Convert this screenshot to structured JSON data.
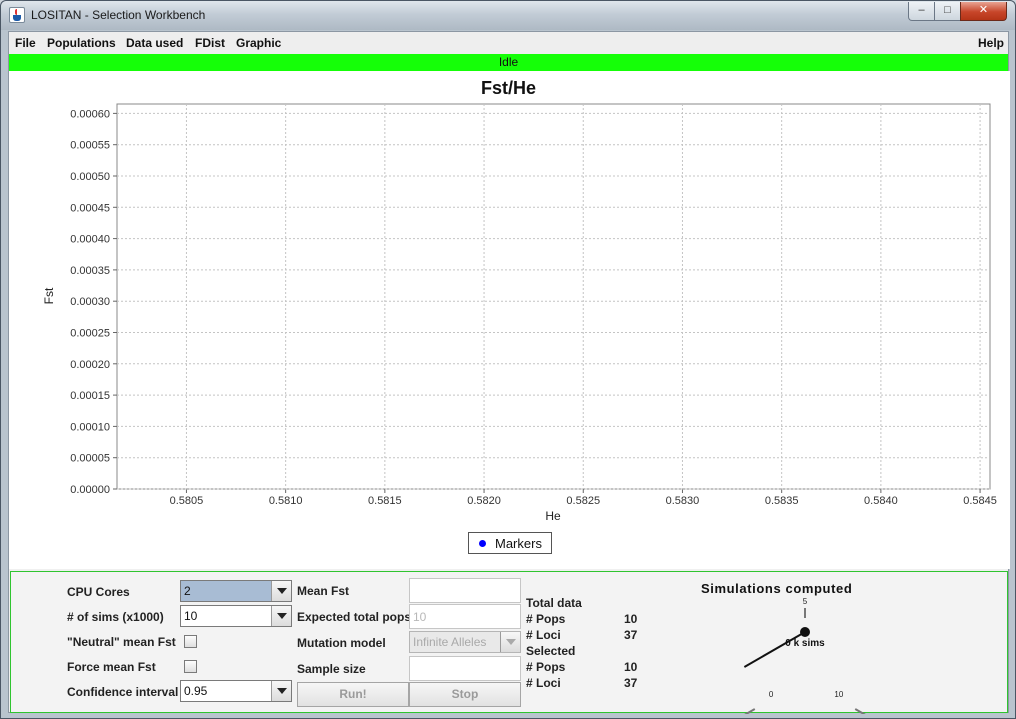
{
  "window": {
    "title": "LOSITAN - Selection Workbench",
    "minimize": "–",
    "maximize": "□",
    "close": "✕"
  },
  "menu": {
    "file": "File",
    "populations": "Populations",
    "data_used": "Data used",
    "fdist": "FDist",
    "graphic": "Graphic",
    "help": "Help"
  },
  "status": "Idle",
  "chart_data": {
    "type": "scatter",
    "title": "Fst/He",
    "xlabel": "He",
    "ylabel": "Fst",
    "xlim": [
      0.58015,
      0.58455
    ],
    "ylim": [
      0.0,
      0.000615
    ],
    "x_ticks": [
      "0.5805",
      "0.5810",
      "0.5815",
      "0.5820",
      "0.5825",
      "0.5830",
      "0.5835",
      "0.5840",
      "0.5845"
    ],
    "x_tick_values": [
      0.5805,
      0.581,
      0.5815,
      0.582,
      0.5825,
      0.583,
      0.5835,
      0.584,
      0.5845
    ],
    "y_ticks": [
      "0.00000",
      "0.00005",
      "0.00010",
      "0.00015",
      "0.00020",
      "0.00025",
      "0.00030",
      "0.00035",
      "0.00040",
      "0.00045",
      "0.00050",
      "0.00055",
      "0.00060"
    ],
    "y_tick_values": [
      0.0,
      5e-05,
      0.0001,
      0.00015,
      0.0002,
      0.00025,
      0.0003,
      0.00035,
      0.0004,
      0.00045,
      0.0005,
      0.00055,
      0.0006
    ],
    "grid": true,
    "legend": "bottom-center",
    "series": [
      {
        "name": "Markers",
        "color": "#0000ff",
        "x": [],
        "y": []
      }
    ]
  },
  "controls": {
    "cpu_cores_label": "CPU Cores",
    "cpu_cores_value": "2",
    "sims_label": "# of sims (x1000)",
    "sims_value": "10",
    "neutral_label": "\"Neutral\" mean Fst",
    "force_label": "Force mean Fst",
    "confidence_label": "Confidence interval",
    "confidence_value": "0.95",
    "mean_fst_label": "Mean Fst",
    "expected_pops_label": "Expected total pops",
    "expected_pops_value": "10",
    "mutation_label": "Mutation model",
    "mutation_value": "Infinite Alleles",
    "sample_size_label": "Sample size",
    "run_label": "Run!",
    "stop_label": "Stop"
  },
  "totals": {
    "total_header": "Total data",
    "pops_label": "# Pops",
    "pops_value": "10",
    "loci_label": "# Loci",
    "loci_value": "37",
    "selected_header": "Selected",
    "sel_pops_label": "# Pops",
    "sel_pops_value": "10",
    "sel_loci_label": "# Loci",
    "sel_loci_value": "37"
  },
  "gauge": {
    "title": "Simulations computed",
    "min_label": "0",
    "mid_label": "5",
    "max_label": "10",
    "readout": "0 k sims",
    "value": 0,
    "max": 10
  }
}
